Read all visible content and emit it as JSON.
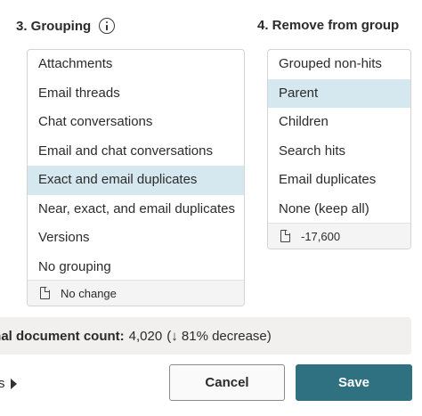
{
  "grouping": {
    "title": "3. Grouping",
    "options": [
      {
        "label": "Attachments",
        "selected": false
      },
      {
        "label": "Email threads",
        "selected": false
      },
      {
        "label": "Chat conversations",
        "selected": false
      },
      {
        "label": "Email and chat conversations",
        "selected": false
      },
      {
        "label": "Exact and email duplicates",
        "selected": true
      },
      {
        "label": "Near, exact, and email duplicates",
        "selected": false
      },
      {
        "label": "Versions",
        "selected": false
      },
      {
        "label": "No grouping",
        "selected": false
      }
    ],
    "footer": "No change"
  },
  "remove": {
    "title": "4. Remove from group",
    "options": [
      {
        "label": "Grouped non-hits",
        "selected": false
      },
      {
        "label": "Parent",
        "selected": true
      },
      {
        "label": "Children",
        "selected": false
      },
      {
        "label": "Search hits",
        "selected": false
      },
      {
        "label": "Email duplicates",
        "selected": false
      },
      {
        "label": "None (keep all)",
        "selected": false
      }
    ],
    "footer": "-17,600"
  },
  "summary": {
    "label": "inal document count:",
    "value": "4,020",
    "change": "(↓ 81% decrease)"
  },
  "more_link": "s",
  "buttons": {
    "cancel": "Cancel",
    "save": "Save"
  },
  "colors": {
    "selected_bg": "#d5e8ef",
    "primary": "#2f7180"
  },
  "icons": [
    "info-icon",
    "document-icon",
    "caret-right-icon"
  ]
}
